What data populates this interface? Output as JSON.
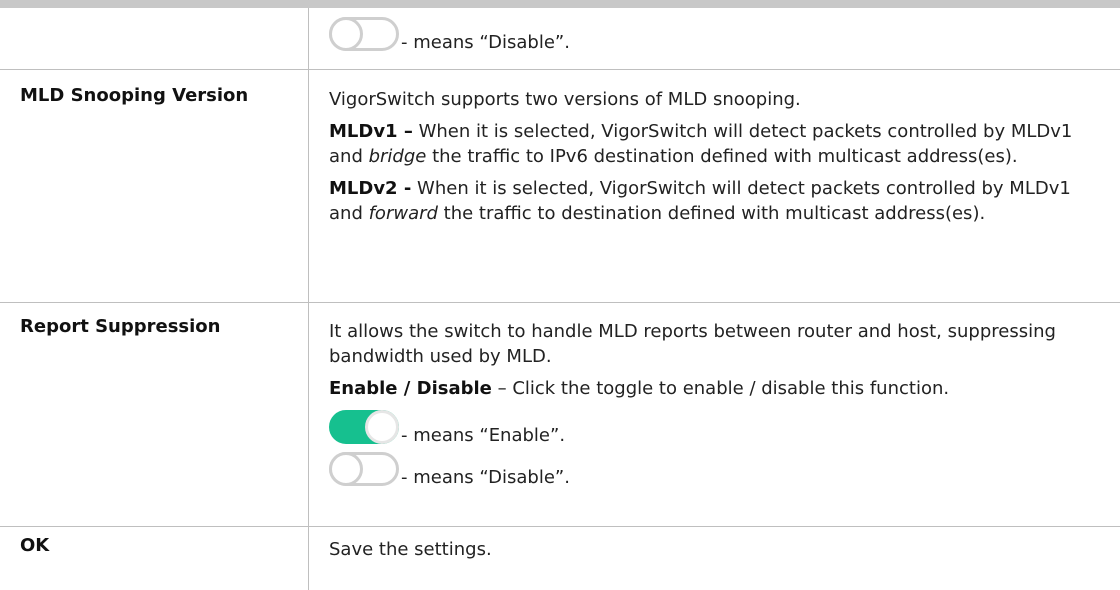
{
  "rows": [
    {
      "toggle_disable_text": "- means “Disable”."
    },
    {
      "label": "MLD Snooping Version",
      "intro": "VigorSwitch supports two versions of MLD snooping.",
      "v1_term": "MLDv1 –",
      "v1_text_a": " When it is selected, VigorSwitch will detect packets controlled by MLDv1 and ",
      "v1_em": "bridge",
      "v1_text_b": " the traffic to IPv6 destination defined with multicast address(es).",
      "v2_term": "MLDv2 -",
      "v2_text_a": " When it is selected, VigorSwitch will detect packets controlled by MLDv1 and ",
      "v2_em": "forward",
      "v2_text_b": " the traffic to destination defined with multicast address(es)."
    },
    {
      "label": "Report Suppression",
      "intro": "It allows the switch to handle MLD reports between router and host, suppressing bandwidth used by MLD.",
      "toggle_term": "Enable / Disable",
      "toggle_desc": " – Click the toggle to enable / disable this function.",
      "toggle_enable_text": "- means “Enable”.",
      "toggle_disable_text": "- means “Disable”."
    },
    {
      "label": "OK",
      "desc": "Save the settings."
    }
  ],
  "colors": {
    "toggle_on": "#16c08f",
    "toggle_off_border": "#cfcfcf"
  },
  "icons": [
    "toggle-off-icon",
    "toggle-on-icon"
  ]
}
